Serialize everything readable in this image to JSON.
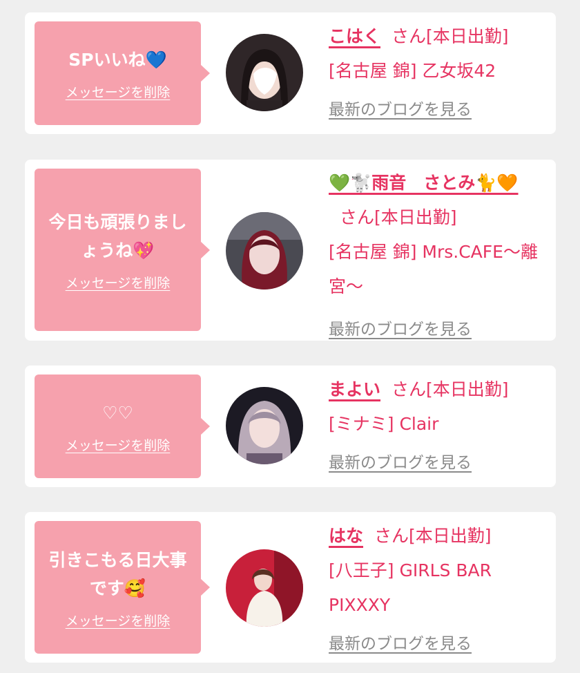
{
  "colors": {
    "background": "#efefef",
    "card": "#ffffff",
    "bubble": "#f6a1ad",
    "name_text": "#e63361",
    "link_gray": "#8a8a8a"
  },
  "items": [
    {
      "message": "SPいいね💙",
      "delete_label": "メッセージを削除",
      "name": "こはく",
      "name_suffix": "さん[本日出勤]",
      "shop": "[名古屋 錦] 乙女坂42",
      "blog_label": "最新のブログを見る"
    },
    {
      "message": "今日も頑張りましょうね💖",
      "delete_label": "メッセージを削除",
      "name": "💚🐩雨音　さとみ🐈🧡",
      "name_suffix": "さん[本日出勤]",
      "shop": "[名古屋 錦] Mrs.CAFE～離宮～",
      "blog_label": "最新のブログを見る"
    },
    {
      "message": "♡♡",
      "delete_label": "メッセージを削除",
      "name": "まよい",
      "name_suffix": "さん[本日出勤]",
      "shop": "[ミナミ] Clair",
      "blog_label": "最新のブログを見る"
    },
    {
      "message": "引きこもる日大事です🥰",
      "delete_label": "メッセージを削除",
      "name": "はな",
      "name_suffix": "さん[本日出勤]",
      "shop": "[八王子] GIRLS BAR PIXXXY",
      "blog_label": "最新のブログを見る"
    }
  ]
}
